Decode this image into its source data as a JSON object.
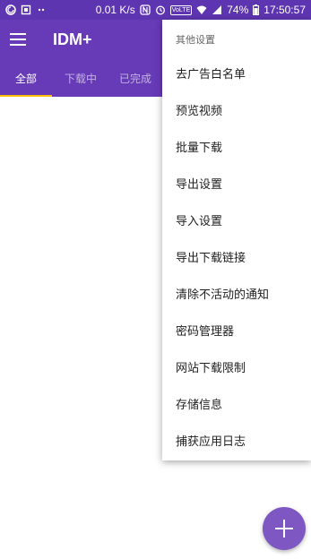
{
  "status_bar": {
    "net_speed": "0.01 K/s",
    "volte": "VoLTE",
    "battery": "74%",
    "time": "17:50:57",
    "icons": [
      "app-notification-icon",
      "sim-icon",
      "more-icon",
      "nfc-icon",
      "alarm-icon",
      "wifi-icon",
      "signal-icon",
      "battery-icon"
    ]
  },
  "app_bar": {
    "title": "IDM+",
    "menu_icon": "hamburger-icon"
  },
  "tabs": [
    {
      "label": "全部",
      "active": true
    },
    {
      "label": "下载中",
      "active": false
    },
    {
      "label": "已完成",
      "active": false
    }
  ],
  "menu": {
    "header": "其他设置",
    "items": [
      "去广告白名单",
      "预览视频",
      "批量下载",
      "导出设置",
      "导入设置",
      "导出下载链接",
      "清除不活动的通知",
      "密码管理器",
      "网站下载限制",
      "存储信息",
      "捕获应用日志"
    ]
  },
  "fab": {
    "icon": "add-icon"
  },
  "colors": {
    "status_bar": "#5E35B1",
    "app_bar": "#673AB7",
    "tab_indicator": "#FFC107",
    "fab": "#7E57C2"
  }
}
